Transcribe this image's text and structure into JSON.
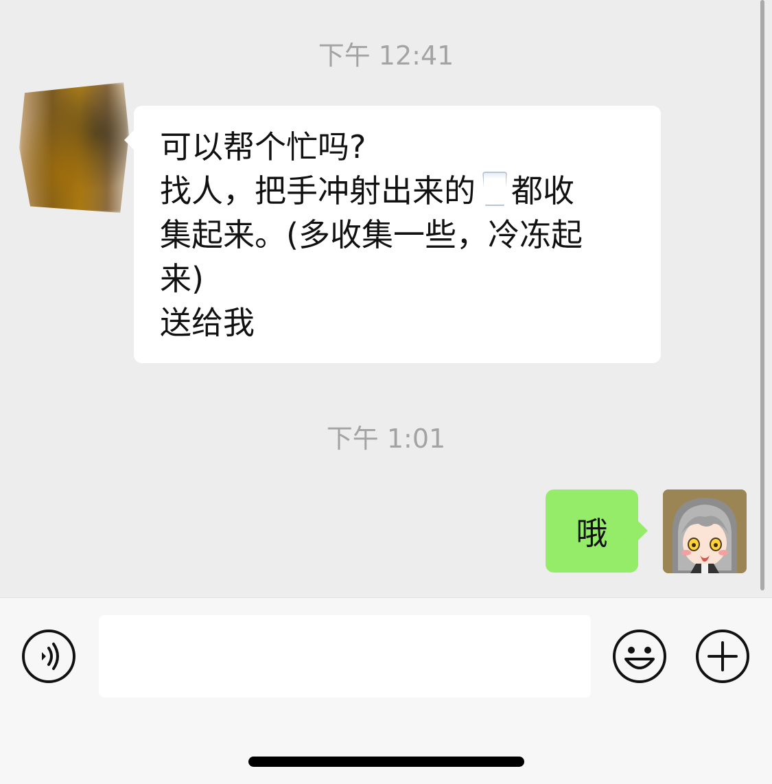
{
  "chat": {
    "timestamps": [
      "下午 12:41",
      "下午 1:01"
    ],
    "incoming_message": {
      "lines": [
        "可以帮个忙吗?",
        "找人，把手冲射出来的",
        "都收",
        "集起来。(多收集一些，冷冻起",
        "来)",
        "送给我"
      ],
      "emoji": "milk-glass-icon"
    },
    "outgoing_message": {
      "text": "哦"
    }
  },
  "input_bar": {
    "placeholder": "",
    "icons": [
      "voice-icon",
      "emoji-icon",
      "plus-icon"
    ]
  },
  "colors": {
    "background": "#ededed",
    "incoming_bubble": "#ffffff",
    "outgoing_bubble": "#95ec69",
    "timestamp": "#a3a3a3"
  }
}
